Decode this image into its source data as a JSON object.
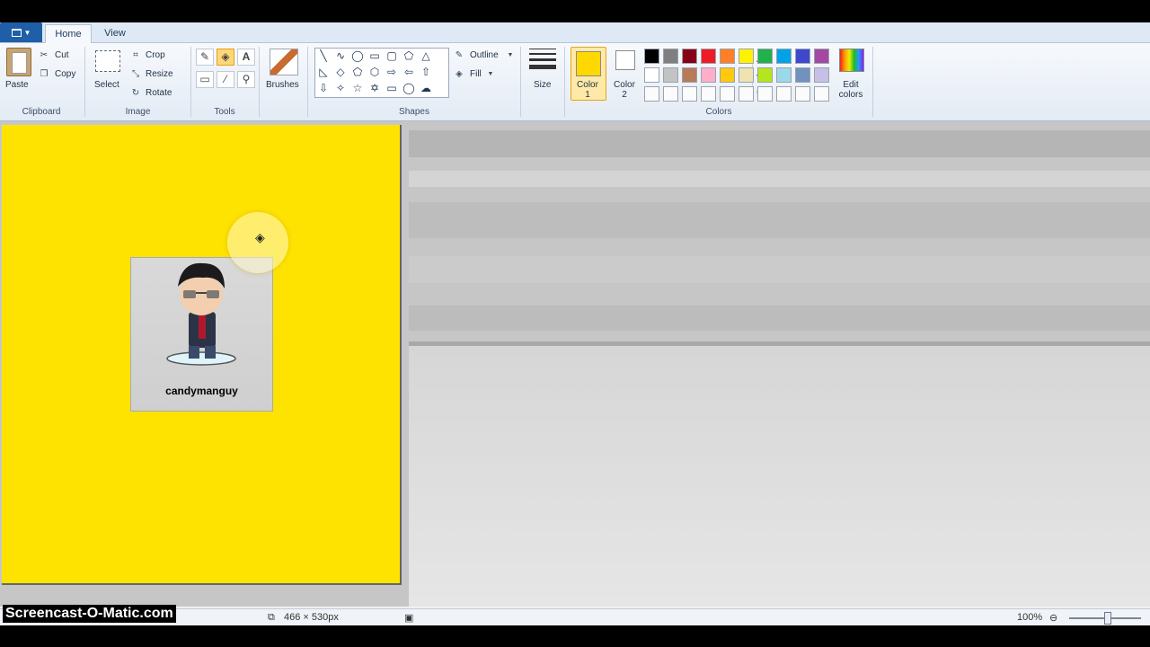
{
  "tabs": [
    {
      "label": "Home",
      "active": true
    },
    {
      "label": "View",
      "active": false
    }
  ],
  "clipboard": {
    "paste": "Paste",
    "cut": "Cut",
    "copy": "Copy",
    "label": "Clipboard"
  },
  "image": {
    "select": "Select",
    "crop": "Crop",
    "resize": "Resize",
    "rotate": "Rotate",
    "label": "Image"
  },
  "tools": {
    "label": "Tools",
    "text_tool": "A"
  },
  "brushes": {
    "label": "Brushes"
  },
  "shapes": {
    "label": "Shapes",
    "outline": "Outline",
    "fill": "Fill"
  },
  "size": {
    "label": "Size"
  },
  "colors": {
    "color1_label": "Color 1",
    "color2_label": "Color 2",
    "edit_label": "Edit colors",
    "group_label": "Colors",
    "color1": "#ffd800",
    "color2": "#ffffff",
    "palette_row1": [
      "#000000",
      "#7f7f7f",
      "#880015",
      "#ed1c24",
      "#ff7f27",
      "#fff200",
      "#22b14c",
      "#00a2e8",
      "#3f48cc",
      "#a349a4"
    ],
    "palette_row2": [
      "#ffffff",
      "#c3c3c3",
      "#b97a57",
      "#ffaec9",
      "#ffc90e",
      "#efe4b0",
      "#b5e61d",
      "#99d9ea",
      "#7092be",
      "#c8bfe7"
    ]
  },
  "canvas": {
    "background": "#ffe300",
    "avatar_name": "candymanguy"
  },
  "status": {
    "dimensions": "466 × 530px",
    "zoom": "100%"
  },
  "watermark": "Screencast-O-Matic.com"
}
